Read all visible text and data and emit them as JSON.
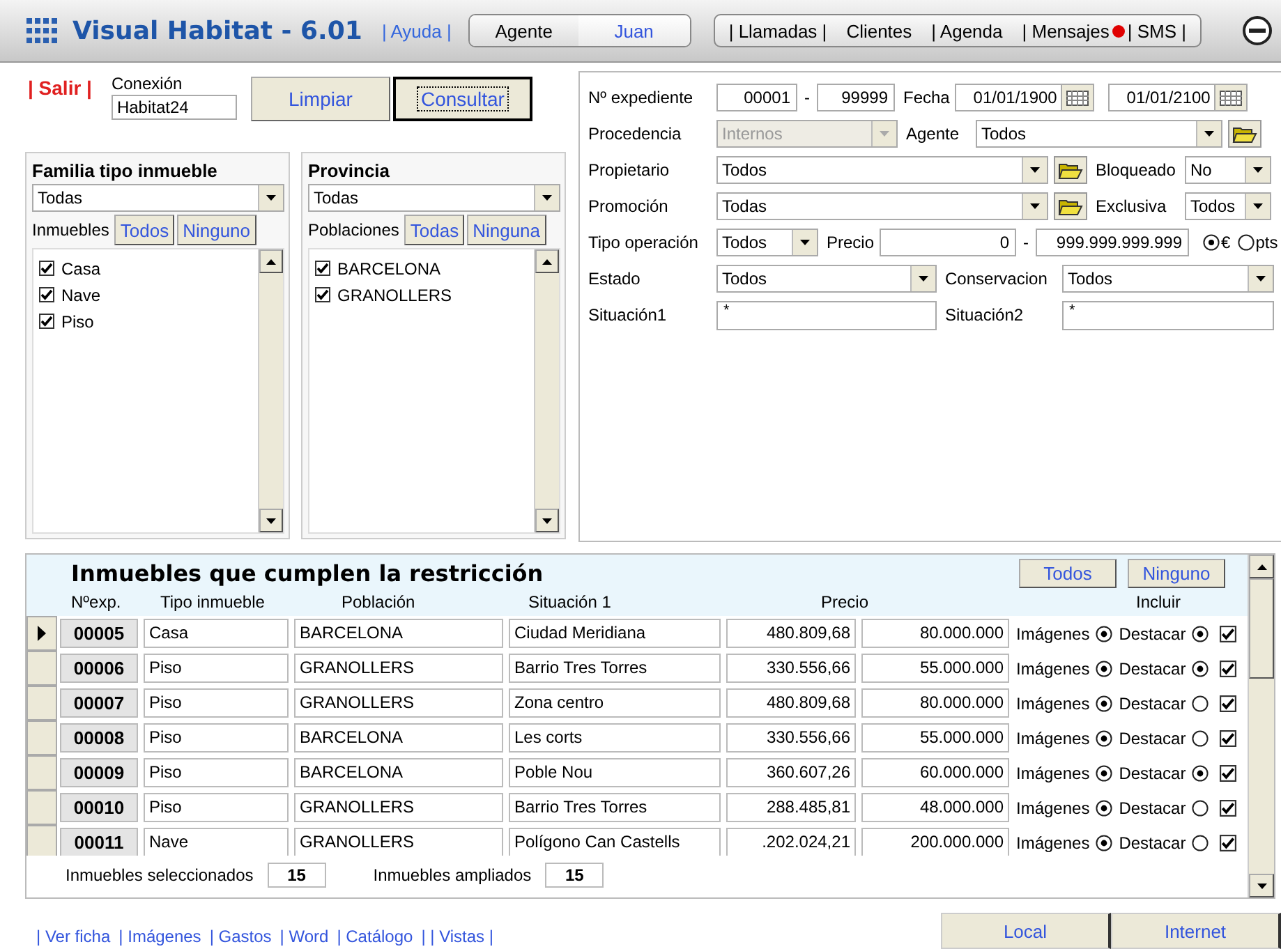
{
  "app": {
    "title": "Visual Habitat - 6.01",
    "help": "| Ayuda |"
  },
  "user": {
    "label": "Agente",
    "value": "Juan"
  },
  "nav": [
    {
      "kind": "link",
      "label": "| Llamadas |"
    },
    {
      "kind": "link",
      "label": "Clientes"
    },
    {
      "kind": "link",
      "label": "| Agenda"
    },
    {
      "kind": "link",
      "label": "| Mensajes"
    },
    {
      "kind": "dot"
    },
    {
      "kind": "link",
      "label": "| SMS |"
    }
  ],
  "session": {
    "exit": "| Salir |",
    "connection_label": "Conexión",
    "connection": "Habitat24"
  },
  "buttons": [
    {
      "label": "Limpiar",
      "focused": false
    },
    {
      "label": "Consultar",
      "focused": true
    }
  ],
  "panels": [
    {
      "title": "Familia tipo inmueble",
      "select": "Todas",
      "list_label": "Inmuebles",
      "all": "Todos",
      "none": "Ninguno",
      "items": [
        {
          "label": "Casa",
          "checked": true
        },
        {
          "label": "Nave",
          "checked": true
        },
        {
          "label": "Piso",
          "checked": true
        }
      ]
    },
    {
      "title": "Provincia",
      "select": "Todas",
      "list_label": "Poblaciones",
      "all": "Todas",
      "none": "Ninguna",
      "items": [
        {
          "label": "BARCELONA",
          "checked": true
        },
        {
          "label": "GRANOLLERS",
          "checked": true
        }
      ]
    }
  ],
  "filters": {
    "expediente": {
      "label": "Nº expediente",
      "from": "00001",
      "sep": "-",
      "to": "99999"
    },
    "fecha": {
      "label": "Fecha",
      "from": "01/01/1900",
      "to": "01/01/2100"
    },
    "procedencia": {
      "label": "Procedencia",
      "value": "Internos",
      "disabled": true
    },
    "agente": {
      "label": "Agente",
      "value": "Todos",
      "disabled": false
    },
    "propietario": {
      "label": "Propietario",
      "value": "Todos",
      "disabled": false
    },
    "bloqueado": {
      "label": "Bloqueado",
      "value": "No",
      "disabled": false
    },
    "promocion": {
      "label": "Promoción",
      "value": "Todas",
      "disabled": false
    },
    "exclusiva": {
      "label": "Exclusiva",
      "value": "Todos",
      "disabled": false
    },
    "tipo_operacion": {
      "label": "Tipo operación",
      "value": "Todos",
      "disabled": false
    },
    "precio": {
      "label": "Precio",
      "from": "0",
      "sep": "-",
      "to": "999.999.999.999"
    },
    "currency": [
      {
        "label": "€",
        "selected": true
      },
      {
        "label": "pts",
        "selected": false
      }
    ],
    "estado": {
      "label": "Estado",
      "value": "Todos",
      "disabled": false
    },
    "conservacion": {
      "label": "Conservacion",
      "value": "Todos",
      "disabled": false
    },
    "situacion1": {
      "label": "Situación1",
      "value": "*"
    },
    "situacion2": {
      "label": "Situación2",
      "value": "*"
    }
  },
  "results": {
    "title": "Inmuebles que cumplen la restricción",
    "all": "Todos",
    "none": "Ninguno",
    "columns": [
      "Nºexp.",
      "Tipo inmueble",
      "Población",
      "Situación 1",
      "Precio",
      "Incluir"
    ],
    "rows": [
      {
        "selected": true,
        "exp": "00005",
        "tipo": "Casa",
        "poblacion": "BARCELONA",
        "situacion": "Ciudad Meridiana",
        "precio_eur": "480.809,68",
        "precio_pts": "80.000.000",
        "images_label": "Imágenes",
        "imagenes": true,
        "destacar_label": "Destacar",
        "destacar": true,
        "incluir": true
      },
      {
        "selected": false,
        "exp": "00006",
        "tipo": "Piso",
        "poblacion": "GRANOLLERS",
        "situacion": "Barrio Tres Torres",
        "precio_eur": "330.556,66",
        "precio_pts": "55.000.000",
        "images_label": "Imágenes",
        "imagenes": true,
        "destacar_label": "Destacar",
        "destacar": true,
        "incluir": true
      },
      {
        "selected": false,
        "exp": "00007",
        "tipo": "Piso",
        "poblacion": "GRANOLLERS",
        "situacion": "Zona centro",
        "precio_eur": "480.809,68",
        "precio_pts": "80.000.000",
        "images_label": "Imágenes",
        "imagenes": true,
        "destacar_label": "Destacar",
        "destacar": false,
        "incluir": true
      },
      {
        "selected": false,
        "exp": "00008",
        "tipo": "Piso",
        "poblacion": "BARCELONA",
        "situacion": "Les corts",
        "precio_eur": "330.556,66",
        "precio_pts": "55.000.000",
        "images_label": "Imágenes",
        "imagenes": true,
        "destacar_label": "Destacar",
        "destacar": false,
        "incluir": true
      },
      {
        "selected": false,
        "exp": "00009",
        "tipo": "Piso",
        "poblacion": "BARCELONA",
        "situacion": "Poble Nou",
        "precio_eur": "360.607,26",
        "precio_pts": "60.000.000",
        "images_label": "Imágenes",
        "imagenes": true,
        "destacar_label": "Destacar",
        "destacar": true,
        "incluir": true
      },
      {
        "selected": false,
        "exp": "00010",
        "tipo": "Piso",
        "poblacion": "GRANOLLERS",
        "situacion": "Barrio Tres Torres",
        "precio_eur": "288.485,81",
        "precio_pts": "48.000.000",
        "images_label": "Imágenes",
        "imagenes": true,
        "destacar_label": "Destacar",
        "destacar": false,
        "incluir": true
      },
      {
        "selected": false,
        "exp": "00011",
        "tipo": "Nave",
        "poblacion": "GRANOLLERS",
        "situacion": "Polígono Can Castells",
        "precio_eur": ".202.024,21",
        "precio_pts": "200.000.000",
        "images_label": "Imágenes",
        "imagenes": true,
        "destacar_label": "Destacar",
        "destacar": false,
        "incluir": true
      }
    ],
    "footer": {
      "selected_label": "Inmuebles seleccionados",
      "selected_count": "15",
      "expanded_label": "Inmuebles ampliados",
      "expanded_count": "15"
    }
  },
  "links": [
    "| Ver ficha",
    "| Imágenes",
    "| Gastos",
    "| Word",
    "| Catálogo",
    "| | Vistas |"
  ],
  "bottom_buttons": [
    "Local",
    "Internet"
  ]
}
